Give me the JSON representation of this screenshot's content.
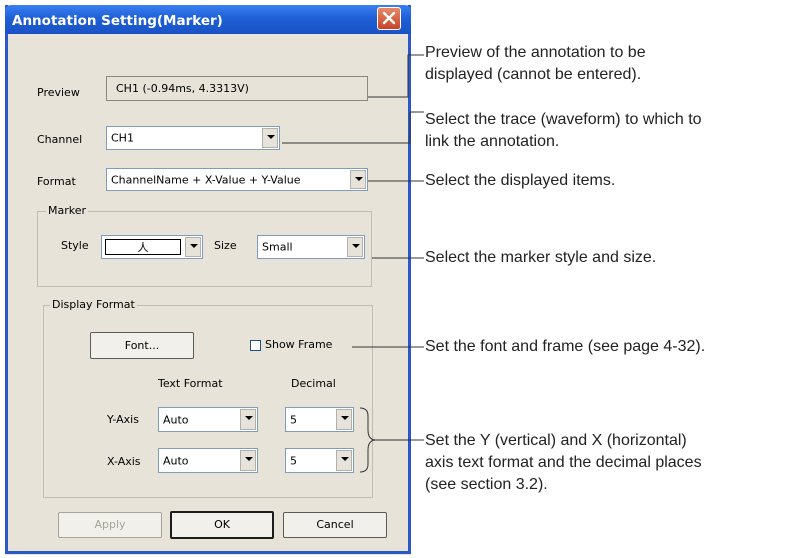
{
  "dialog": {
    "title": "Annotation Setting(Marker)",
    "preview": {
      "label": "Preview",
      "value": "CH1 (-0.94ms, 4.3313V)"
    },
    "channel": {
      "label": "Channel",
      "value": "CH1"
    },
    "format": {
      "label": "Format",
      "value": "ChannelName + X-Value + Y-Value"
    },
    "marker": {
      "group_title": "Marker",
      "style_label": "Style",
      "style_value": "人",
      "size_label": "Size",
      "size_value": "Small"
    },
    "display_format": {
      "group_title": "Display Format",
      "font_button": "Font...",
      "show_frame_label": "Show Frame",
      "show_frame_checked": false,
      "col_text_format": "Text Format",
      "col_decimal": "Decimal",
      "y_axis": {
        "label": "Y-Axis",
        "text_format": "Auto",
        "decimal": "5"
      },
      "x_axis": {
        "label": "X-Axis",
        "text_format": "Auto",
        "decimal": "5"
      }
    },
    "buttons": {
      "apply": "Apply",
      "ok": "OK",
      "cancel": "Cancel"
    }
  },
  "annotations": {
    "preview": [
      "Preview of the annotation to be",
      "displayed (cannot be entered)."
    ],
    "channel": [
      "Select the trace (waveform) to which to",
      "link the annotation."
    ],
    "format": [
      "Select the displayed items."
    ],
    "marker": [
      "Select the marker style and size."
    ],
    "font": [
      "Set the font and frame (see page 4-32)."
    ],
    "axis": [
      "Set the Y  (vertical) and X (horizontal)",
      "axis text format and the decimal places",
      "(see section 3.2)."
    ]
  }
}
